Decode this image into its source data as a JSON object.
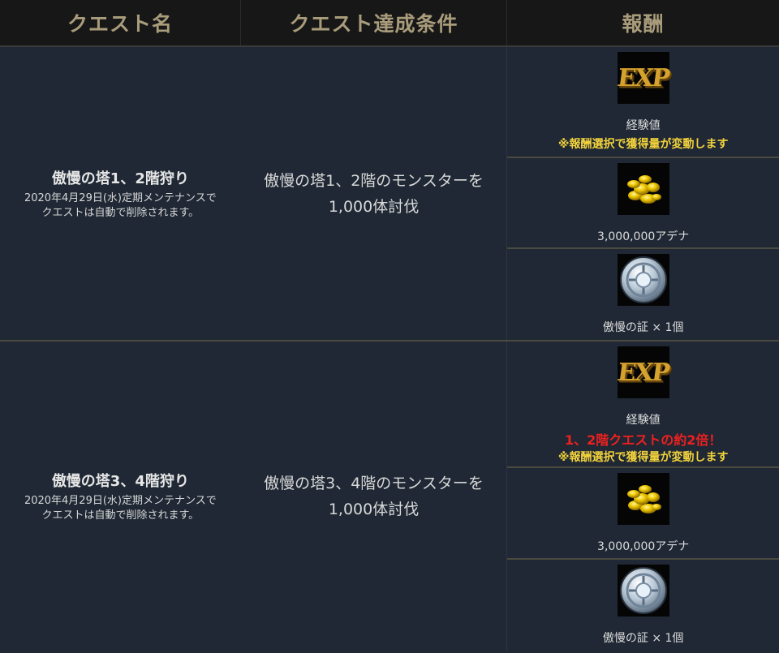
{
  "headers": [
    "クエスト名",
    "クエスト達成条件",
    "報酬"
  ],
  "rows": [
    {
      "name": "傲慢の塔1、2階狩り",
      "note_line1": "2020年4月29日(水)定期メンテナンスで",
      "note_line2": "クエストは自動で削除されます。",
      "condition_line1": "傲慢の塔1、2階のモンスターを",
      "condition_line2": "1,000体討伐",
      "rewards": [
        {
          "icon": "exp-icon",
          "label": "経験値",
          "note": "※報酬選択で獲得量が変動します"
        },
        {
          "icon": "gold-coins-icon",
          "label": "3,000,000アデナ"
        },
        {
          "icon": "silver-emblem-icon",
          "label": "傲慢の証 × 1個"
        }
      ]
    },
    {
      "name": "傲慢の塔3、4階狩り",
      "note_line1": "2020年4月29日(水)定期メンテナンスで",
      "note_line2": "クエストは自動で削除されます。",
      "condition_line1": "傲慢の塔3、4階のモンスターを",
      "condition_line2": "1,000体討伐",
      "rewards": [
        {
          "icon": "exp-icon",
          "label": "経験値",
          "highlight": "1、2階クエストの約2倍！",
          "note": "※報酬選択で獲得量が変動します"
        },
        {
          "icon": "gold-coins-icon",
          "label": "3,000,000アデナ"
        },
        {
          "icon": "silver-emblem-icon",
          "label": "傲慢の証 × 1個"
        }
      ]
    }
  ],
  "exp_icon_text": "EXP",
  "colors": {
    "background": "#1f2834",
    "header_bg": "#171717",
    "header_text": "#a99c7b",
    "note_yellow": "#f2d23c",
    "note_red": "#ee2020"
  }
}
